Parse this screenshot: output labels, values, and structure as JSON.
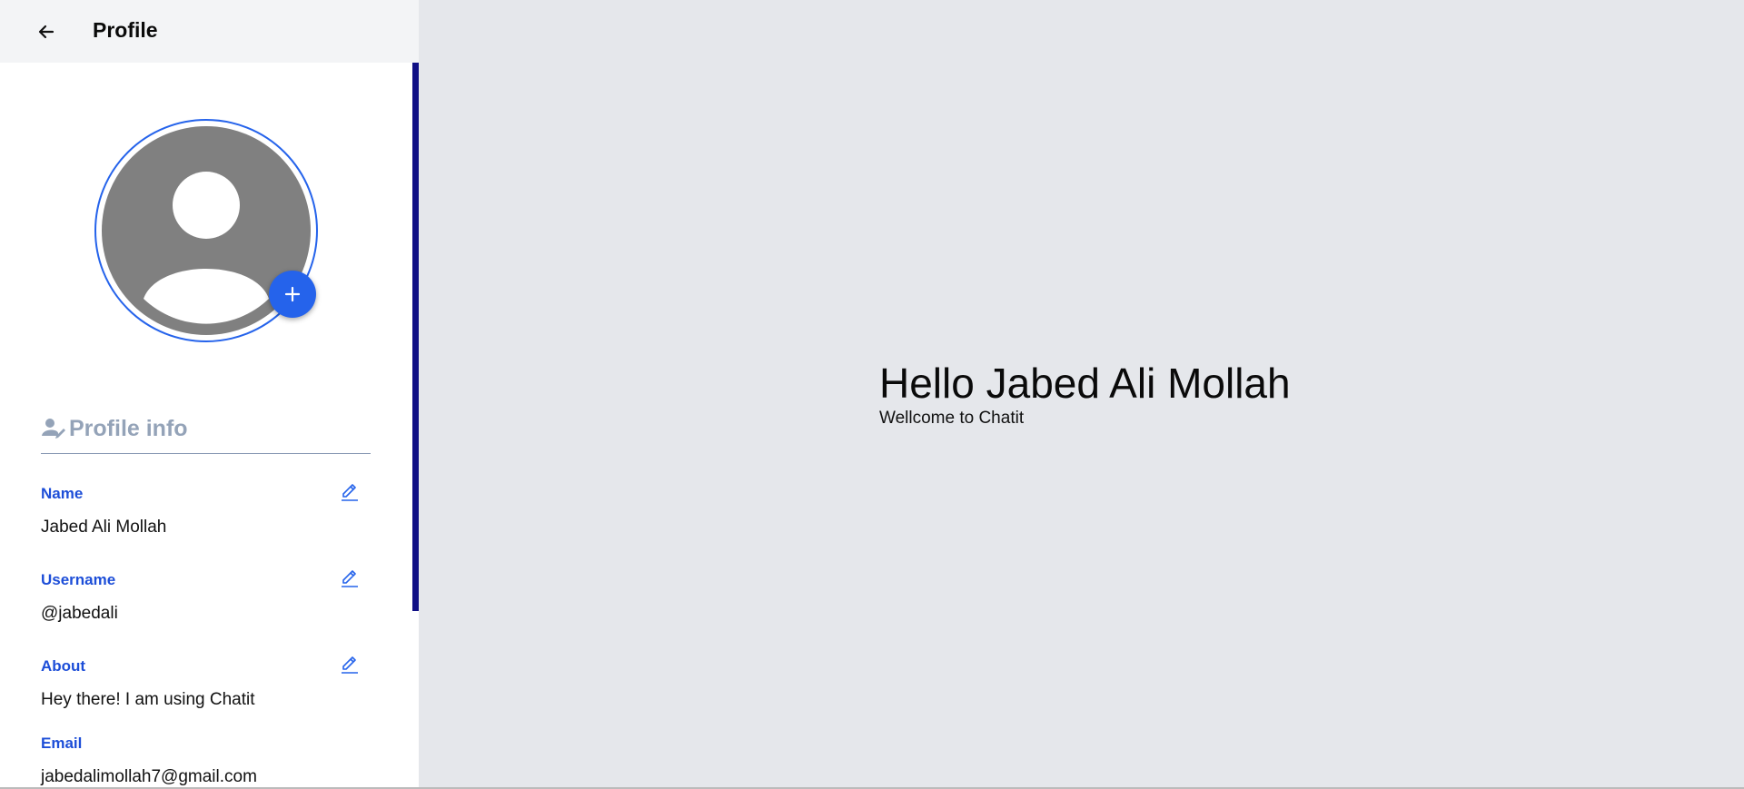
{
  "header": {
    "title": "Profile"
  },
  "profile_info": {
    "heading": "Profile info",
    "fields": [
      {
        "label": "Name",
        "value": "Jabed Ali Mollah",
        "editable": true
      },
      {
        "label": "Username",
        "value": "@jabedali",
        "editable": true
      },
      {
        "label": "About",
        "value": "Hey there! I am using Chatit",
        "editable": true
      },
      {
        "label": "Email",
        "value": "jabedalimollah7@gmail.com",
        "editable": false
      }
    ]
  },
  "main": {
    "greeting": "Hello Jabed Ali Mollah",
    "subtitle": "Wellcome to Chatit"
  },
  "colors": {
    "accent": "#2563eb",
    "label_blue": "#1d4ed8",
    "scrollbar": "#0f0f85",
    "avatar_gray": "#808080",
    "main_bg": "#e5e7eb"
  },
  "icons": {
    "back": "arrow-left-icon",
    "add_photo": "plus-icon",
    "profile_info": "user-pen-icon",
    "edit": "pencil-icon"
  }
}
